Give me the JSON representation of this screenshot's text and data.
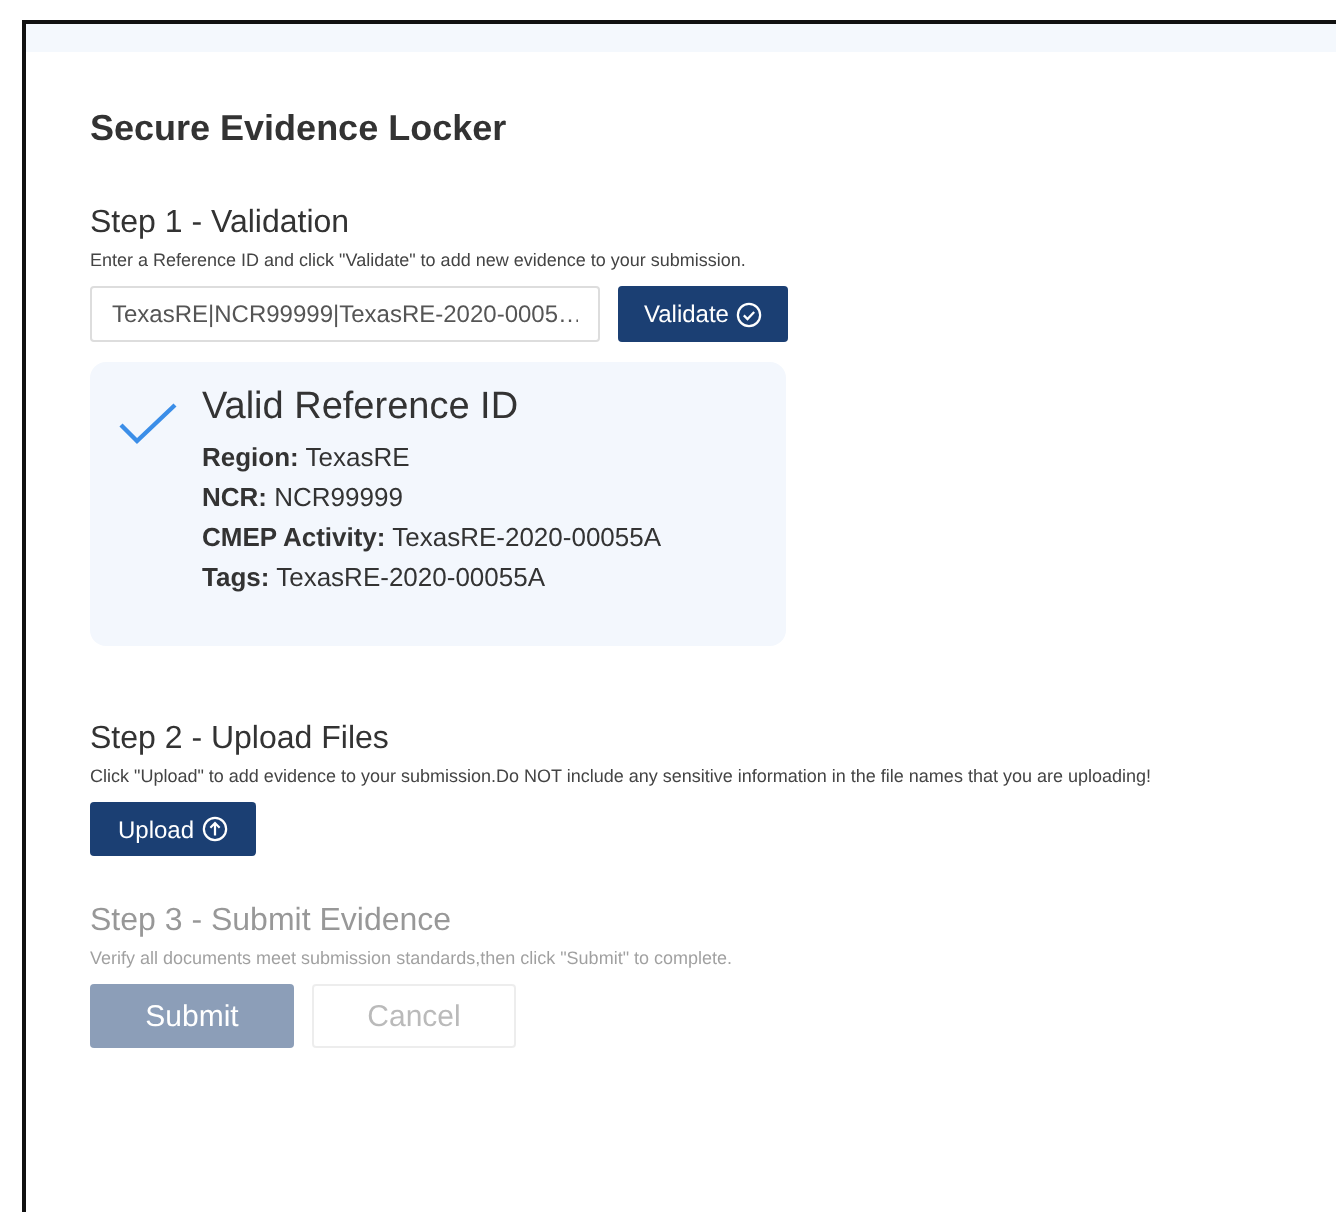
{
  "page": {
    "title": "Secure Evidence Locker"
  },
  "steps": [
    {
      "kind": "validation",
      "heading": "Step 1 - Validation",
      "description": "Enter a Reference ID and click \"Validate\" to add new evidence to your submission.",
      "disabled": false,
      "field": {
        "value": "TexasRE|NCR99999|TexasRE-2020-0005…"
      },
      "button": {
        "label": "Validate"
      },
      "result": {
        "title": "Valid Reference ID",
        "details": [
          {
            "label": "Region:",
            "value": "TexasRE"
          },
          {
            "label": "NCR:",
            "value": "NCR99999"
          },
          {
            "label": "CMEP Activity:",
            "value": "TexasRE-2020-00055A"
          },
          {
            "label": "Tags:",
            "value": "TexasRE-2020-00055A"
          }
        ]
      }
    },
    {
      "kind": "upload",
      "heading": "Step 2 - Upload Files",
      "description": "Click \"Upload\" to add evidence to your submission.Do NOT include any sensitive information in the file names that you are uploading!",
      "disabled": false,
      "button": {
        "label": "Upload"
      }
    },
    {
      "kind": "submit",
      "heading": "Step 3 - Submit Evidence",
      "description": "Verify all documents meet submission standards,then click \"Submit\" to complete.",
      "disabled": true,
      "buttons": [
        {
          "label": "Submit",
          "kind": "primary"
        },
        {
          "label": "Cancel",
          "kind": "secondary"
        }
      ]
    }
  ]
}
